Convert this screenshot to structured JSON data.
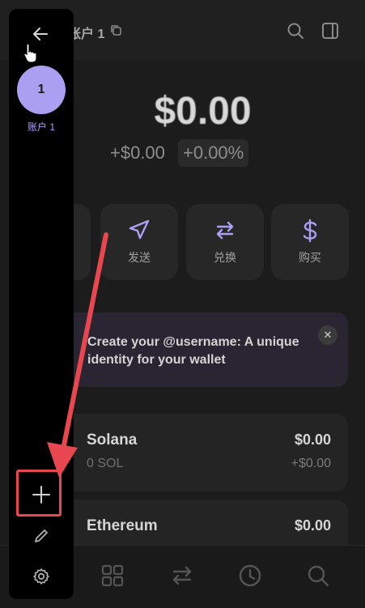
{
  "header": {
    "account_label": "账户 1"
  },
  "balance": {
    "amount": "$0.00",
    "change_amount": "+$0.00",
    "change_percent": "+0.00%"
  },
  "actions": [
    {
      "label": "发送",
      "icon": "send-icon"
    },
    {
      "label": "兑换",
      "icon": "swap-icon"
    },
    {
      "label": "购买",
      "icon": "dollar-icon"
    }
  ],
  "banner": {
    "text": "Create your @username: A unique identity for your wallet",
    "close": "✕"
  },
  "tokens": [
    {
      "name": "Solana",
      "amount": "0 SOL",
      "value": "$0.00",
      "change": "+$0.00"
    },
    {
      "name": "Ethereum",
      "amount": "",
      "value": "$0.00",
      "change": ""
    }
  ],
  "sidebar": {
    "avatar_initial": "1",
    "account_name": "账户 1"
  },
  "colors": {
    "accent": "#ab9ff2",
    "annotation": "#e8474f",
    "background": "#1c1c1c"
  }
}
